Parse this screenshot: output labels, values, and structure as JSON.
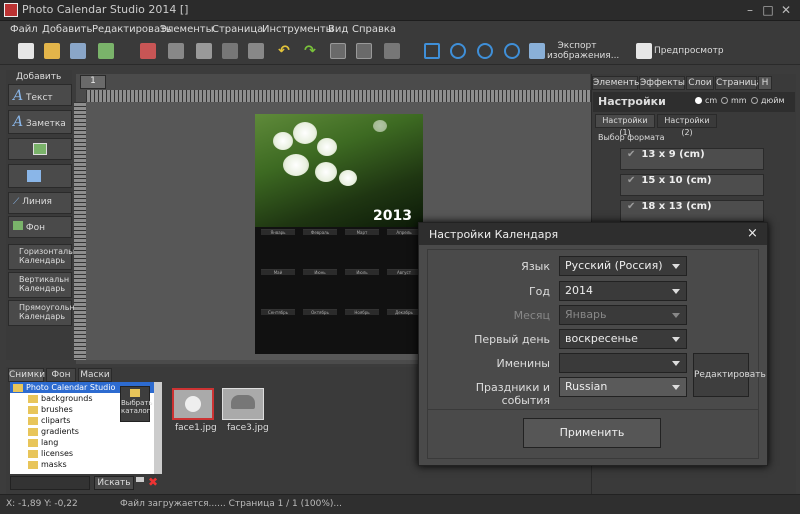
{
  "window": {
    "title": "Photo Calendar Studio 2014 []"
  },
  "menu": [
    "Файл",
    "Добавить",
    "Редактировать",
    "Элементы",
    "Страница",
    "Инструменты",
    "Вид",
    "Справка"
  ],
  "toolbar": {
    "export_label_1": "Экспорт",
    "export_label_2": "изображения...",
    "preview_label": "Предпросмотр"
  },
  "left_panel": {
    "header": "Добавить",
    "text_btn": "Текст",
    "note_btn": "Заметка",
    "line_btn": "Линия",
    "bg_btn": "Фон",
    "horiz_cal": "Горизонтальн Календарь",
    "vert_cal": "Вертикальн Календарь",
    "rect_cal": "Прямоугольн Календарь"
  },
  "canvas": {
    "tab": "1",
    "calendar_year": "2013"
  },
  "right_panel": {
    "tabs": [
      "Элементы",
      "Эффекты",
      "Слои",
      "Страница",
      "Н"
    ],
    "title": "Настройки",
    "units": [
      "cm",
      "mm",
      "дюйм"
    ],
    "subtabs": [
      "Настройки (1)",
      "Настройки (2)"
    ],
    "format_label": "Выбор формата",
    "formats": [
      "13 x 9 (cm)",
      "15 x 10 (cm)",
      "18 x 13 (cm)"
    ]
  },
  "bottom_panel": {
    "tabs": [
      "Снимки",
      "Фон",
      "Маски"
    ],
    "tree_root": "Photo Calendar Studio",
    "tree_items": [
      "backgrounds",
      "brushes",
      "cliparts",
      "gradients",
      "lang",
      "licenses",
      "masks"
    ],
    "choose_catalog": "Выбрать каталог",
    "search_btn": "Искать",
    "search_value": "",
    "thumbs": [
      "face1.jpg",
      "face3.jpg"
    ]
  },
  "status": {
    "coords": "X: -1,89 Y: -0,22",
    "message": "Файл загружается...... Страница 1 / 1 (100%)..."
  },
  "dialog": {
    "title": "Настройки Календаря",
    "close": "×",
    "language_label": "Язык",
    "language_value": "Русский (Россия)",
    "year_label": "Год",
    "year_value": "2014",
    "month_label": "Месяц",
    "month_value": "Январь",
    "first_day_label": "Первый день",
    "first_day_value": "воскресенье",
    "nameday_label": "Именины",
    "nameday_value": "",
    "holidays_label": "Праздники и события",
    "holidays_value": "Russian",
    "edit_btn": "Редактировать",
    "apply_btn": "Применить"
  },
  "colors": {
    "accent": "#3f8fd8",
    "dialog_bg": "#4a4a4a"
  }
}
